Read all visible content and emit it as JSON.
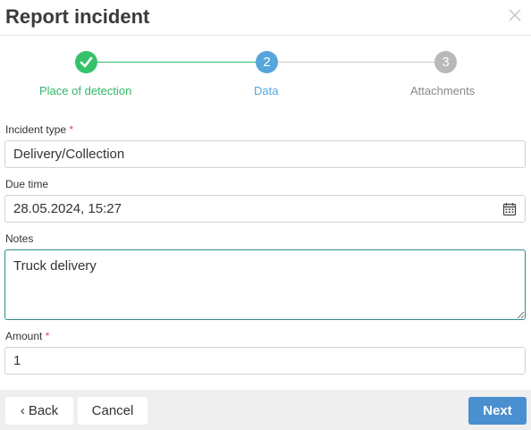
{
  "dialog": {
    "title": "Report incident"
  },
  "stepper": {
    "steps": [
      {
        "number": "1",
        "label": "Place of detection",
        "state": "done"
      },
      {
        "number": "2",
        "label": "Data",
        "state": "active"
      },
      {
        "number": "3",
        "label": "Attachments",
        "state": "pending"
      }
    ]
  },
  "form": {
    "incident_type": {
      "label": "Incident type",
      "required_mark": "*",
      "value": "Delivery/Collection"
    },
    "due_time": {
      "label": "Due time",
      "value": "28.05.2024, 15:27"
    },
    "notes": {
      "label": "Notes",
      "value": "Truck delivery"
    },
    "amount": {
      "label": "Amount",
      "required_mark": "*",
      "value": "1"
    }
  },
  "footer": {
    "back_chevron": "‹",
    "back_label": "Back",
    "cancel_label": "Cancel",
    "next_label": "Next"
  },
  "colors": {
    "done": "#35c26b",
    "active": "#56a6dc",
    "pending": "#b9b9b9",
    "primary_button": "#4a8fcf"
  },
  "icons": {
    "close": "close-icon",
    "check": "check-icon",
    "calendar": "calendar-icon",
    "back": "chevron-left-icon"
  }
}
